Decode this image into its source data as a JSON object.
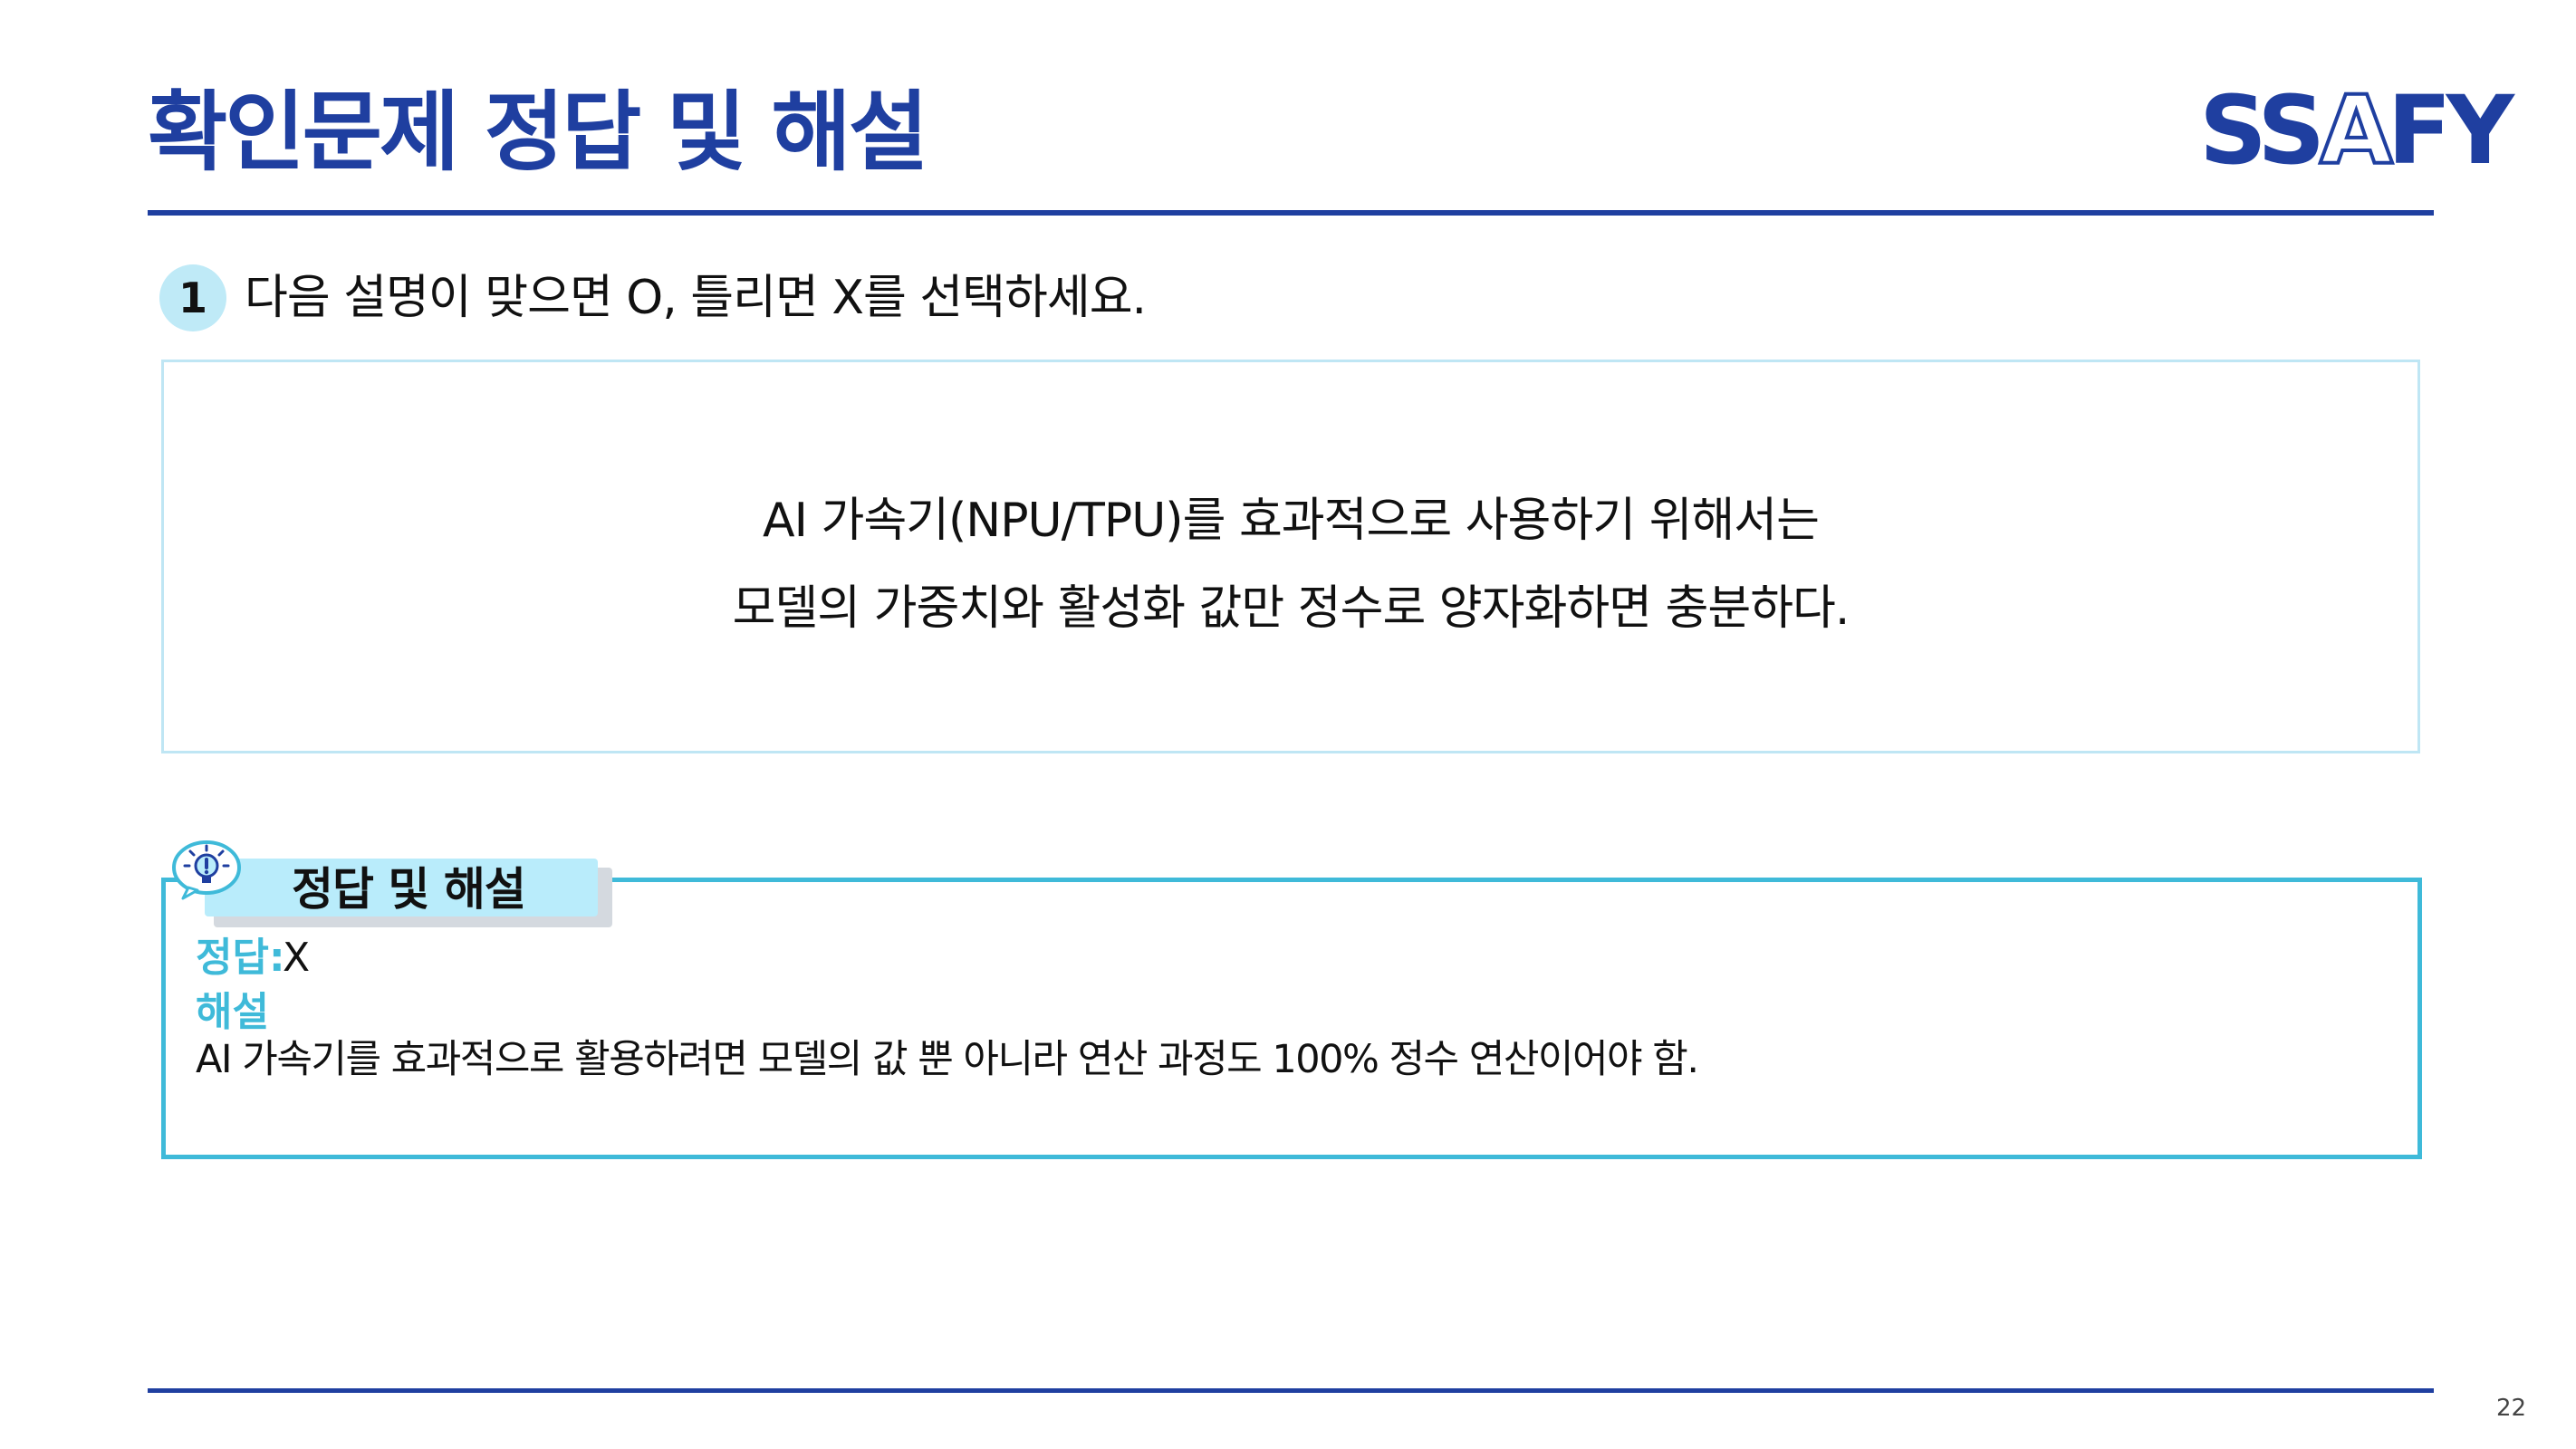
{
  "header": {
    "title": "확인문제 정답 및 해설",
    "logo_text_before": "SS",
    "logo_text_highlight": "A",
    "logo_text_after": "FY"
  },
  "question": {
    "number": "1",
    "instruction": "다음 설명이 맞으면 O, 틀리면 X를 선택하세요.",
    "statement_line1": "AI 가속기(NPU/TPU)를 효과적으로 사용하기 위해서는",
    "statement_line2": "모델의 가중치와 활성화 값만 정수로 양자화하면 충분하다."
  },
  "answer_section": {
    "tab_label": "정답 및 해설",
    "answer_label": "정답:",
    "answer_value": "X",
    "explanation_label": "해설",
    "explanation_text": "AI 가속기를 효과적으로 활용하려면 모델의 값 뿐 아니라 연산 과정도 100% 정수 연산이어야 함."
  },
  "footer": {
    "page_number": "22"
  },
  "colors": {
    "primary": "#1f3fa0",
    "accent": "#3fbad9",
    "badge_bg": "#bfeaf7",
    "tab_bg": "#b9ecfb",
    "box_border": "#bfe6f4"
  },
  "icons": {
    "bulb": "lightbulb-icon"
  }
}
